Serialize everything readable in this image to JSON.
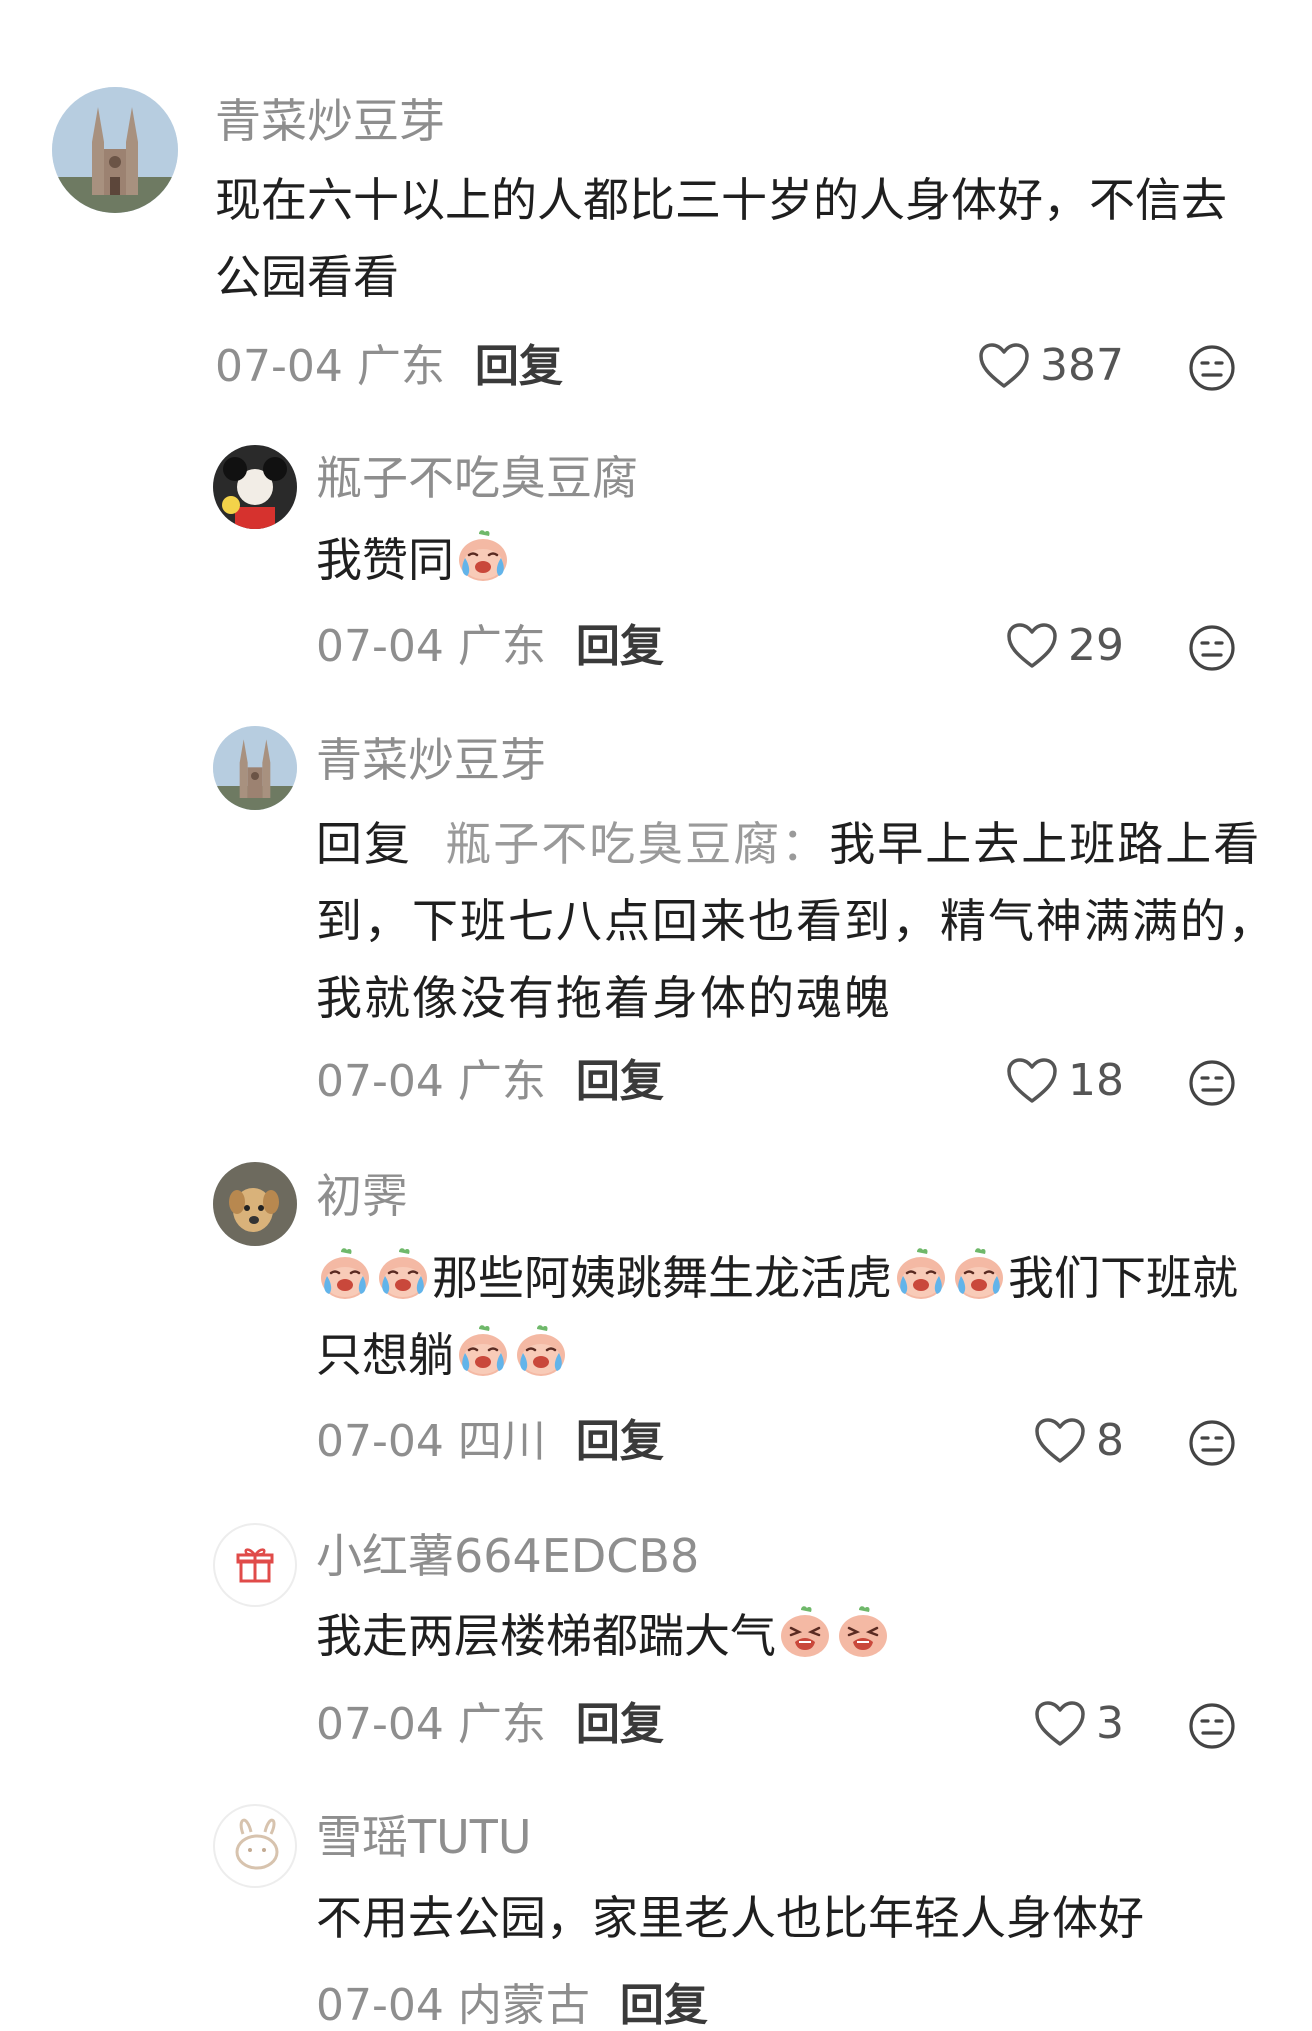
{
  "comments": [
    {
      "username": "青菜炒豆芽",
      "text": "现在六十以上的人都比三十岁的人身体好，不信去公园看看",
      "date": "07-04",
      "location": "广东",
      "reply_label": "回复",
      "likes": "387",
      "avatar": "cathedral-photo"
    },
    {
      "username": "瓶子不吃臭豆腐",
      "text": "我赞同",
      "date": "07-04",
      "location": "广东",
      "reply_label": "回复",
      "likes": "29",
      "avatar": "mickey-photo"
    },
    {
      "username": "青菜炒豆芽",
      "reply_prefix": "回复",
      "reply_target": "瓶子不吃臭豆腐：",
      "text": "我早上去上班路上看到，下班七八点回来也看到，精气神满满的，我就像没有拖着身体的魂魄",
      "date": "07-04",
      "location": "广东",
      "reply_label": "回复",
      "likes": "18",
      "avatar": "cathedral-photo"
    },
    {
      "username": "初霁",
      "text_a": "那些阿姨跳舞生龙活虎",
      "text_b": "我们下班就只想躺",
      "date": "07-04",
      "location": "四川",
      "reply_label": "回复",
      "likes": "8",
      "avatar": "dog-photo"
    },
    {
      "username": "小红薯664EDCB8",
      "text": "我走两层楼梯都踹大气",
      "date": "07-04",
      "location": "广东",
      "reply_label": "回复",
      "likes": "3",
      "avatar": "gift-icon"
    },
    {
      "username": "雪瑶TUTU",
      "text": "不用去公园，家里老人也比年轻人身体好",
      "date": "07-04",
      "location": "内蒙古",
      "reply_label": "回复",
      "avatar": "rabbit-icon"
    }
  ],
  "icons": {
    "like": "heart-outline-icon",
    "dislike": "neutral-face-icon",
    "emoji_cry": "crying-peach-emoji",
    "emoji_sob": "sobbing-peach-emoji"
  },
  "colors": {
    "text": "#1f1f1f",
    "muted": "#8e8e8e",
    "background": "#ffffff"
  }
}
